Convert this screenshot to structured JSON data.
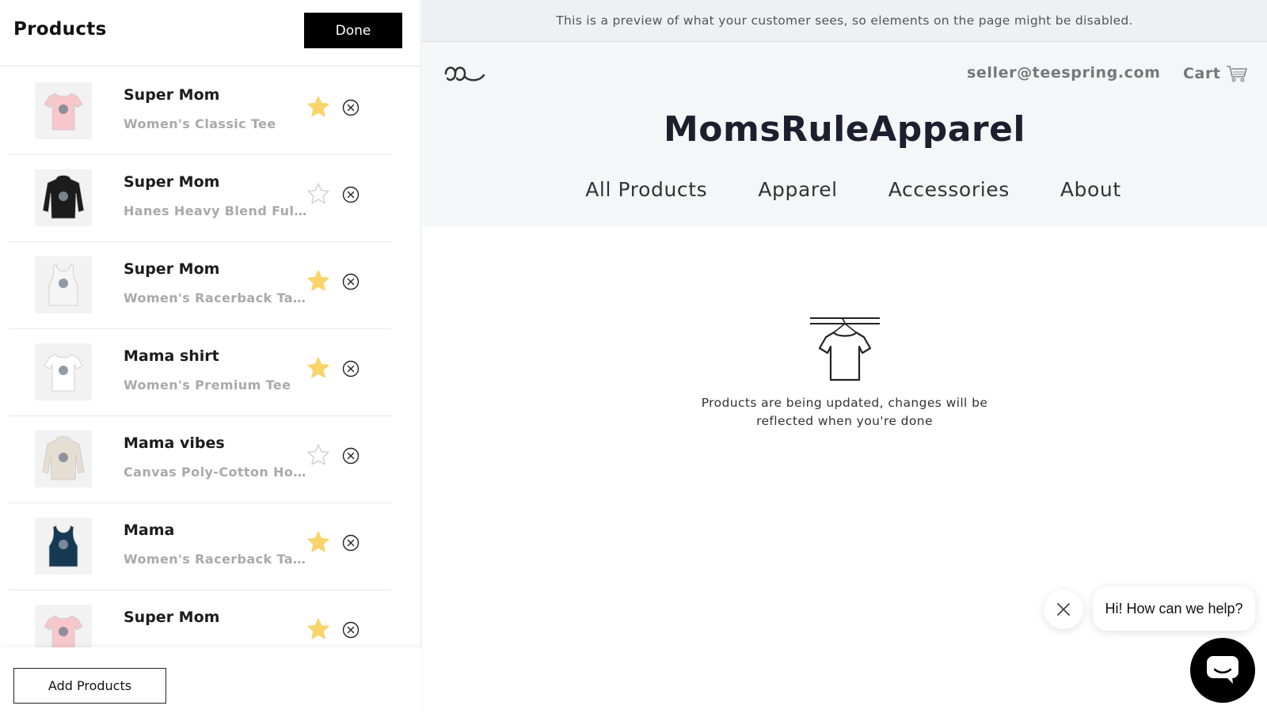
{
  "panel": {
    "title": "Products",
    "done_label": "Done",
    "add_label": "Add Products"
  },
  "products": [
    {
      "name": "Super Mom",
      "type": "Women's Classic Tee",
      "starred": true,
      "thumb": "pink-tee-icon",
      "color": "#f7c7cb"
    },
    {
      "name": "Super Mom",
      "type": "Hanes Heavy Blend Full Zi...",
      "starred": false,
      "thumb": "black-hoodie-icon",
      "color": "#1c1c1c"
    },
    {
      "name": "Super Mom",
      "type": "Women's Racerback Tank",
      "starred": true,
      "thumb": "white-tank-icon",
      "color": "#f5f5f5"
    },
    {
      "name": "Mama shirt",
      "type": "Women's Premium Tee",
      "starred": true,
      "thumb": "white-tee-icon",
      "color": "#ffffff"
    },
    {
      "name": "Mama vibes",
      "type": "Canvas Poly-Cotton Hood...",
      "starred": false,
      "thumb": "cream-hoodie-icon",
      "color": "#e6ded2"
    },
    {
      "name": "Mama",
      "type": "Women's Racerback Tank",
      "starred": true,
      "thumb": "navy-tank-icon",
      "color": "#173a54"
    },
    {
      "name": "Super Mom",
      "type": "",
      "starred": true,
      "thumb": "pink-tee-icon",
      "color": "#f7c7cb"
    }
  ],
  "preview": {
    "banner": "This is a preview of what your customer sees, so elements on the page might be disabled.",
    "email": "seller@teespring.com",
    "cart_label": "Cart",
    "store_name": "MomsRuleApparel",
    "nav": [
      "All Products",
      "Apparel",
      "Accessories",
      "About"
    ],
    "empty_line1": "Products are being updated, changes will be",
    "empty_line2": "reflected when you're done"
  },
  "chat": {
    "greeting": "Hi! How can we help?"
  },
  "colors": {
    "star_on": "#f8d46b",
    "star_off": "#cfcfcf",
    "header_bg": "#f4f6f8"
  }
}
